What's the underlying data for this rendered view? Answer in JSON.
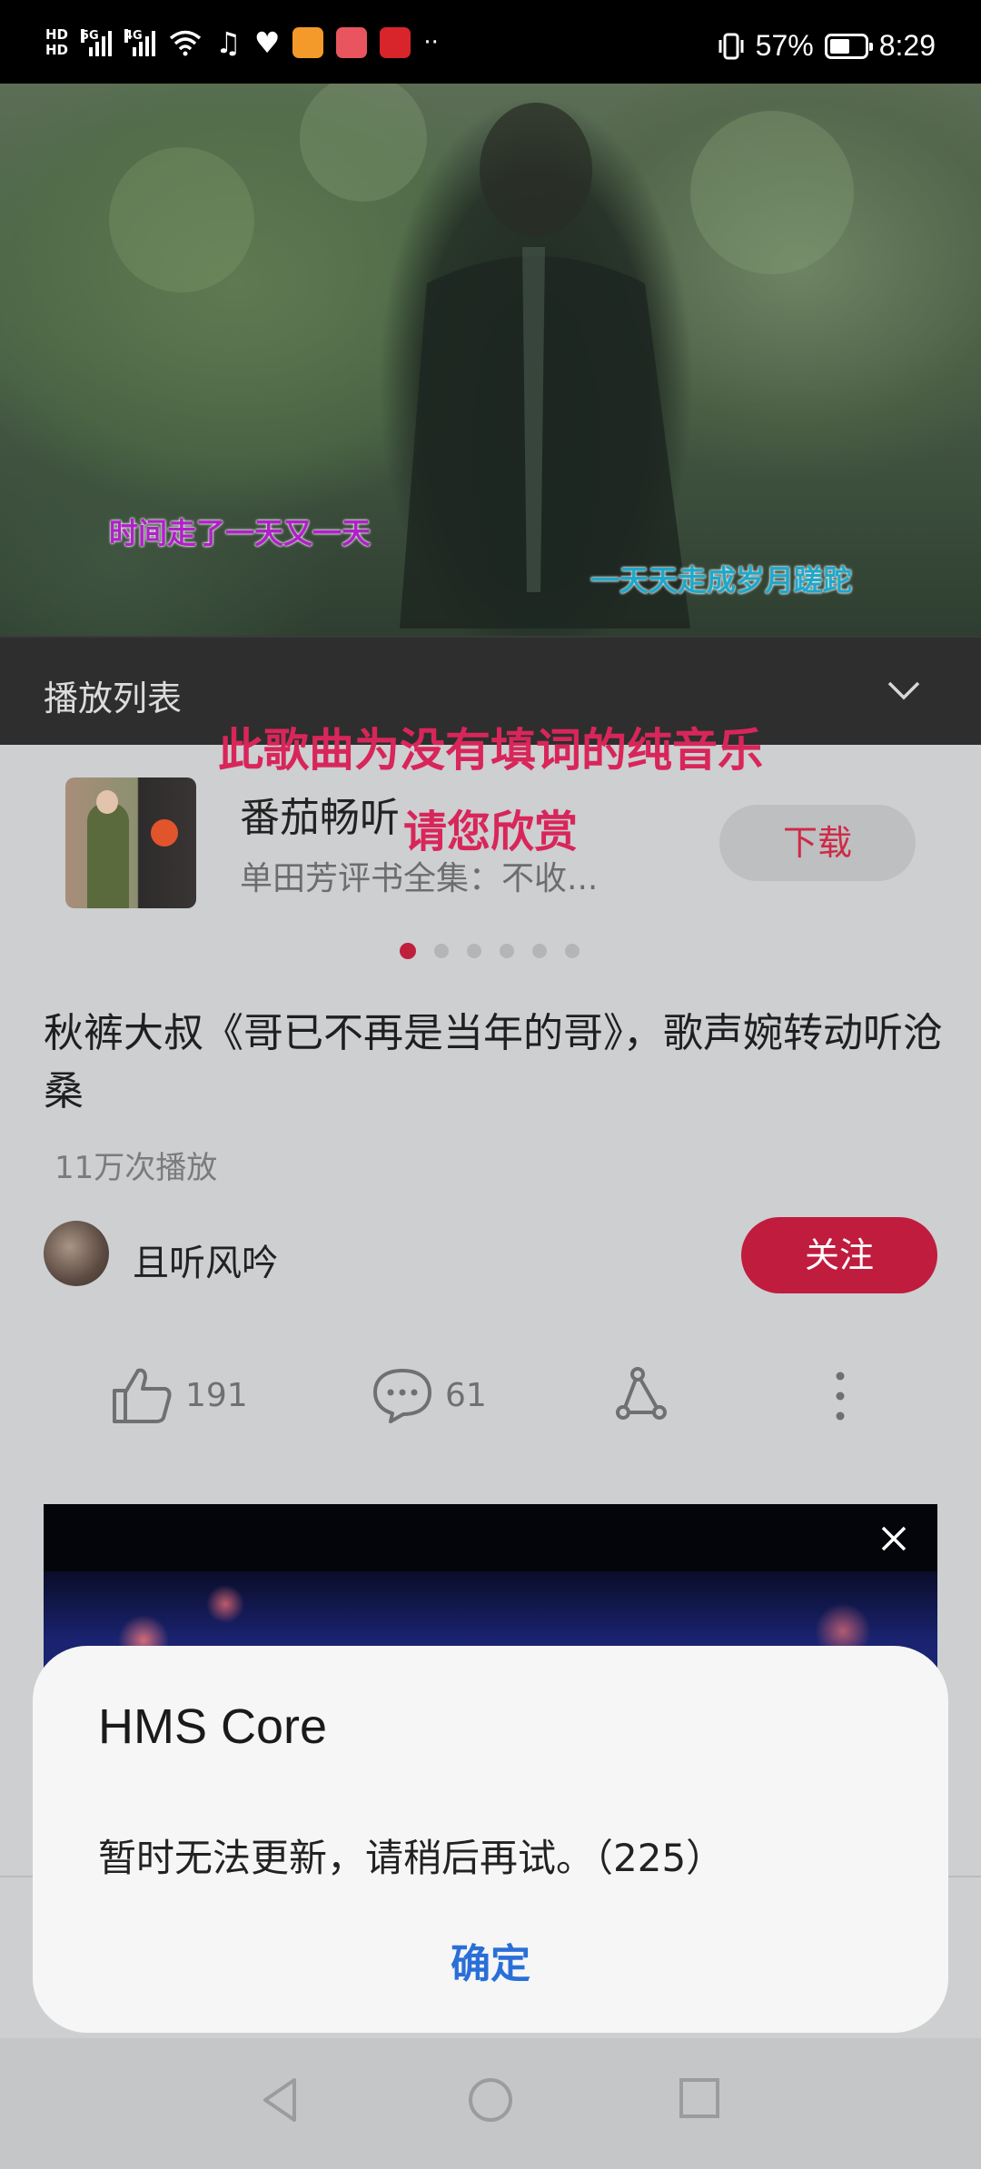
{
  "status_bar": {
    "hd_top": "HD",
    "hd_bottom": "HD",
    "sig1_label": "5G",
    "sig2_label": "4G",
    "battery_text": "57%",
    "battery_level": 0.57,
    "time": "8:29",
    "app_icons": [
      "wifi-icon",
      "music-note-icon",
      "heart-rate-icon",
      "video-app-icon",
      "reader-app-icon",
      "red-app-icon",
      "more-dots-icon"
    ]
  },
  "video": {
    "lyric_left": "时间走了一天又一天",
    "lyric_right": "一天天走成岁月蹉跎"
  },
  "playlist": {
    "title": "播放列表"
  },
  "overlay": {
    "line1": "此歌曲为没有填词的纯音乐",
    "line2": "请您欣赏"
  },
  "ad": {
    "app_name": "番茄畅听",
    "description": "单田芳评书全集：不收...",
    "download_label": "下载"
  },
  "pager": {
    "count": 6,
    "active_index": 0
  },
  "detail": {
    "title": "秋裤大叔《哥已不再是当年的哥》，歌声婉转动听沧桑",
    "play_count": "11万次播放",
    "author": "且听风吟",
    "follow_label": "关注",
    "likes": "191",
    "comments": "61"
  },
  "dialog": {
    "title": "HMS Core",
    "message": "暂时无法更新，请稍后再试。（225）",
    "ok_label": "确定"
  },
  "colors": {
    "accent_red": "#c01c3e",
    "dialog_button_blue": "#2a6fd8",
    "overlay_text": "#d8265a"
  }
}
